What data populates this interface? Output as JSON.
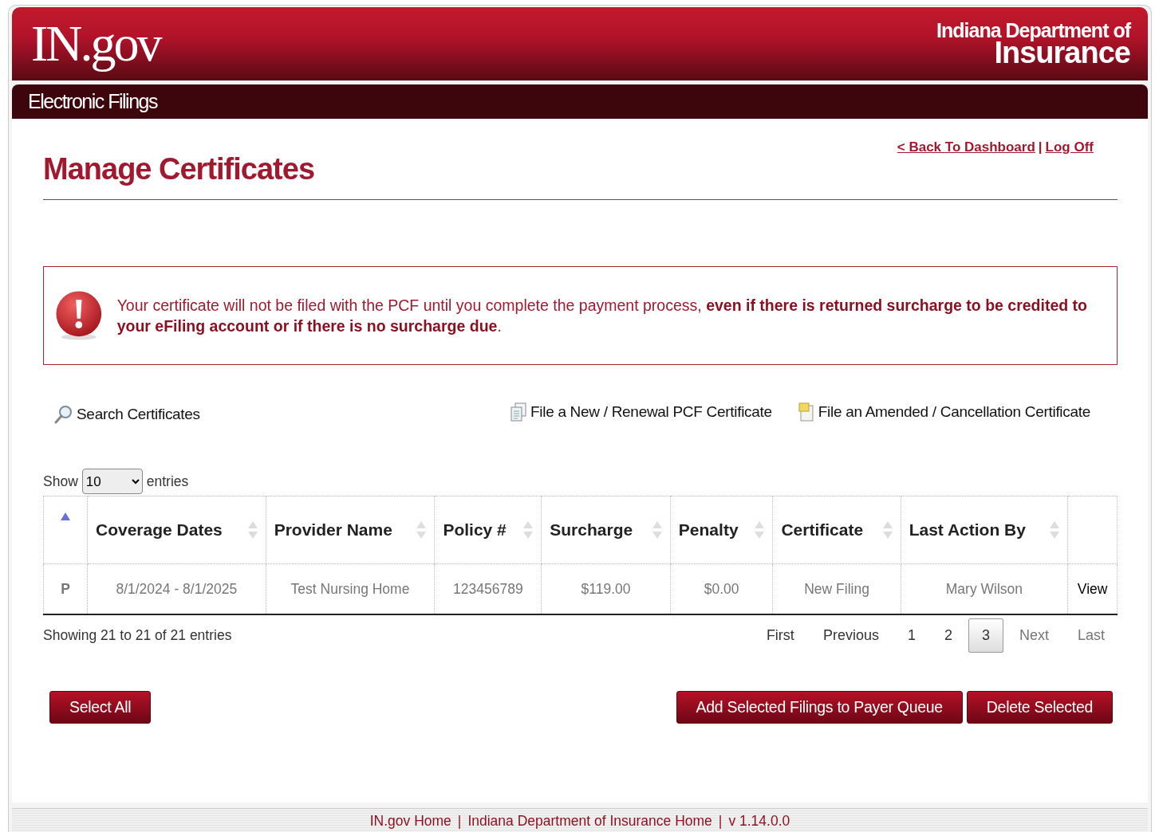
{
  "header": {
    "logo": "IN.gov",
    "agency_line1": "Indiana Department of",
    "agency_line2": "Insurance",
    "section": "Electronic Filings"
  },
  "top_links": {
    "links": [
      "< Back To Dashboard",
      "Log Off"
    ],
    "separator": "|"
  },
  "page_title": "Manage Certificates",
  "alert": {
    "text": "Your certificate will not be filed with the PCF until you complete the payment process, **even if there is returned surcharge to be credited to your eFiling account or if there is no surcharge due**."
  },
  "actions": [
    {
      "kind": "search",
      "label": "Search Certificates"
    },
    {
      "kind": "new",
      "label": "File a New / Renewal PCF Certificate"
    },
    {
      "kind": "amend",
      "label": "File an Amended / Cancellation Certificate"
    }
  ],
  "length": {
    "prefix": "Show",
    "value": "10",
    "suffix": "entries"
  },
  "table": {
    "columns": [
      {
        "sorted": true
      },
      {
        "label": "Coverage Dates",
        "sorted": false
      },
      {
        "label": "Provider Name",
        "sorted": false
      },
      {
        "label": "Policy #",
        "sorted": false
      },
      {
        "label": "Surcharge",
        "sorted": false
      },
      {
        "label": "Penalty",
        "sorted": false
      },
      {
        "label": "Certificate",
        "sorted": false
      },
      {
        "label": "Last Action By",
        "sorted": false
      }
    ],
    "rows": [
      [
        "P",
        "8/1/2024 - 8/1/2025",
        "Test Nursing Home",
        "123456789",
        "$119.00",
        "$0.00",
        "New Filing",
        "Mary Wilson",
        "View"
      ]
    ]
  },
  "info": "Showing 21 to 21 of 21 entries",
  "pagination": [
    {
      "label": "First",
      "kind": "nav",
      "disabled": false
    },
    {
      "label": "Previous",
      "kind": "nav",
      "disabled": false
    },
    {
      "label": "1",
      "kind": "page",
      "selected": false
    },
    {
      "label": "2",
      "kind": "page",
      "selected": false
    },
    {
      "label": "3",
      "kind": "page",
      "selected": true
    },
    {
      "label": "Next",
      "kind": "nav",
      "disabled": true
    },
    {
      "label": "Last",
      "kind": "nav",
      "disabled": true
    }
  ],
  "buttons_left": [
    "Select All"
  ],
  "buttons_right": [
    "Add Selected Filings to Payer Queue",
    "Delete Selected"
  ],
  "footer": {
    "links": [
      "IN.gov Home",
      "Indiana Department of Insurance Home"
    ],
    "separators": [
      "|",
      "|"
    ],
    "version": "v 1.14.0.0"
  }
}
